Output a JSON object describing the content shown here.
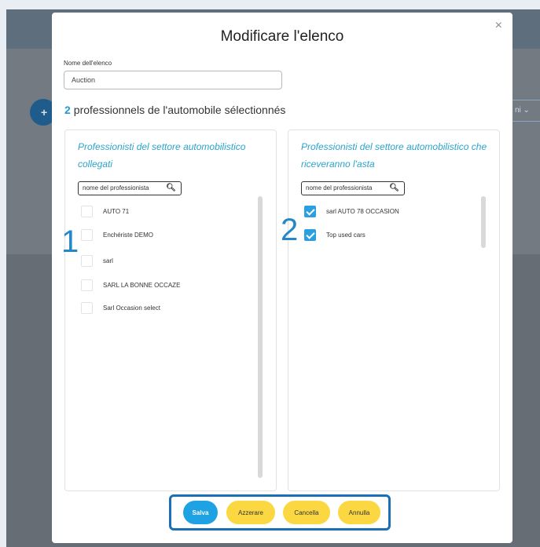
{
  "background": {
    "side_button_label": "ni ⌄"
  },
  "modal": {
    "title": "Modificare l'elenco",
    "close_icon": "×",
    "name_label": "Nome dell'elenco",
    "name_value": "Auction",
    "selected_count": "2",
    "selected_text": "professionnels de l'automobile sélectionnés"
  },
  "left_panel": {
    "title": "Professionisti del settore automobilistico collegati",
    "search_placeholder": "nome del professionista",
    "items": [
      {
        "label": "AUTO 71",
        "checked": false
      },
      {
        "label": "Enchériste DEMO",
        "checked": false
      },
      {
        "label": "sarl",
        "checked": false
      },
      {
        "label": "SARL LA BONNE OCCAZE",
        "checked": false
      },
      {
        "label": "Sarl Occasion select",
        "checked": false
      }
    ]
  },
  "right_panel": {
    "title": "Professionisti del settore automobilistico che riceveranno l'asta",
    "search_placeholder": "nome del professionista",
    "items": [
      {
        "label": "sarl AUTO 78 OCCASION",
        "checked": true
      },
      {
        "label": "Top used cars",
        "checked": true
      }
    ]
  },
  "annotations": {
    "left_number": "1",
    "right_number": "2"
  },
  "buttons": {
    "save": "Salva",
    "reset": "Azzerare",
    "clear": "Cancella",
    "cancel": "Annulla"
  },
  "icons": {
    "search_glyph": "🔍︎",
    "close": "close-icon",
    "search": "search-icon",
    "add": "plus-icon"
  },
  "colors": {
    "accent": "#1e9bd7",
    "title_teal": "#2ba3cc",
    "save_button": "#1ea2e4",
    "yellow_button": "#fbd841",
    "annotation": "#2488c8"
  }
}
